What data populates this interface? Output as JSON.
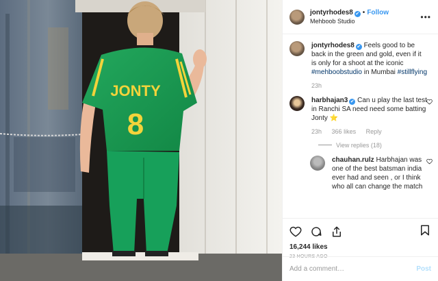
{
  "post": {
    "username": "jontyrhodes8",
    "verified_mark": "✔",
    "follow_label": "Follow",
    "dot": "•",
    "location": "Mehboob Studio",
    "more_label": "•••",
    "caption": {
      "username": "jontyrhodes8",
      "text": "Feels good to be back in the green and gold, even if it is only for a shoot at the iconic",
      "tag1": "#mehboobstudio",
      "text2": "in Mumbai",
      "tag2": "#stillflying",
      "time": "23h"
    },
    "comments": [
      {
        "username": "harbhajan3",
        "text": "Can u play the last test in Ranchi SA need need some batting Jonty",
        "emoji": "⭐",
        "time": "23h",
        "likes": "366 likes",
        "reply_label": "Reply",
        "view_replies": "View replies (18)"
      },
      {
        "username": "chauhan.rulz",
        "text": "Harbhajan was one of the best batsman india ever had and seen , or I think who all can change the match"
      }
    ],
    "likes": "16,244 likes",
    "ago": "23 HOURS AGO",
    "add_comment_placeholder": "Add a comment…",
    "post_button": "Post",
    "jersey_name": "JONTY",
    "jersey_number": "8"
  },
  "colors": {
    "link": "#3897f0",
    "hashtag": "#003569",
    "jersey": "#1e9b55",
    "jersey_text": "#f3d33b"
  },
  "icons": [
    "heart-icon",
    "comment-icon",
    "share-icon",
    "bookmark-icon"
  ]
}
